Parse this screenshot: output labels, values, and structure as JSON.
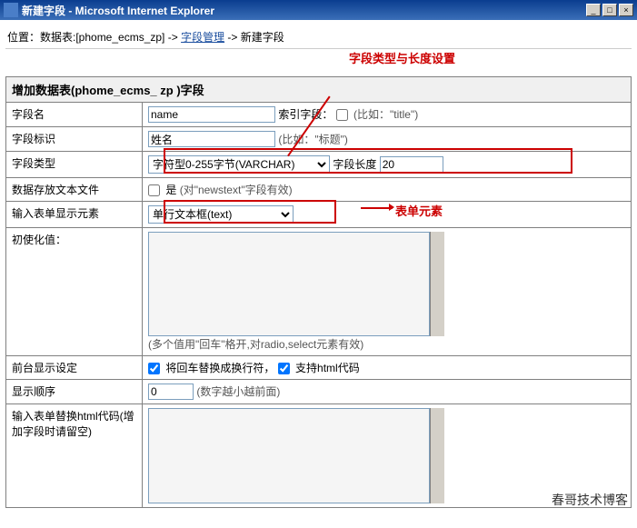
{
  "window": {
    "title": "新建字段 - Microsoft Internet Explorer"
  },
  "breadcrumb": {
    "prefix": "位置：数据表:[phome_ecms_zp] -> ",
    "link": "字段管理",
    "suffix": " -> 新建字段"
  },
  "annotations": {
    "a1": "字段类型与长度设置",
    "a2": "表单元素"
  },
  "form": {
    "header": "增加数据表(phome_ecms_ zp )字段",
    "rows": {
      "field_name": {
        "label": "字段名",
        "value": "name",
        "cb_label": "索引字段：",
        "hint": "(比如：\"title\")"
      },
      "field_ident": {
        "label": "字段标识",
        "value": "姓名",
        "hint": "(比如：\"标题\")"
      },
      "field_type": {
        "label": "字段类型",
        "select": "字符型0-255字节(VARCHAR)",
        "len_label": "字段长度",
        "len_value": "20"
      },
      "store_text": {
        "label": "数据存放文本文件",
        "cb_label": "是",
        "hint": "(对\"newstext\"字段有效)"
      },
      "form_elem": {
        "label": "输入表单显示元素",
        "select": "单行文本框(text)"
      },
      "init_val": {
        "label": "初使化值：",
        "hint": "(多个值用\"回车\"格开,对radio,select元素有效)"
      },
      "front_disp": {
        "label": "前台显示设定",
        "cb1": "将回车替换成换行符，",
        "cb2": "支持html代码"
      },
      "order": {
        "label": "显示顺序",
        "value": "0",
        "hint": "(数字越小越前面)"
      },
      "html_replace": {
        "label": "输入表单替换html代码(增加字段时请留空)"
      }
    }
  },
  "watermark": "春哥技术博客"
}
